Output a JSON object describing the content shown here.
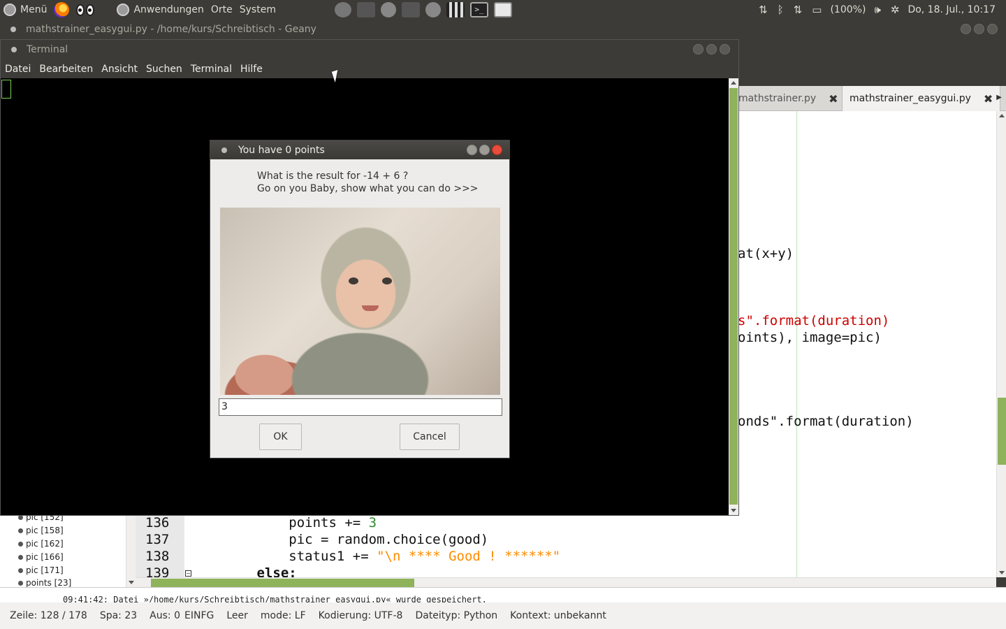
{
  "top_panel": {
    "menu_label": "Menü",
    "applications": "Anwendungen",
    "places": "Orte",
    "system": "System",
    "battery": "(100%)",
    "clock": "Do, 18. Jul., 10:17",
    "tray_icons": [
      "network-arrows-icon",
      "bluetooth-icon",
      "network-arrows-icon",
      "battery-icon",
      "volume-icon",
      "settings-icon"
    ]
  },
  "geany": {
    "window_title": "mathstrainer_easygui.py - /home/kurs/Schreibtisch - Geany",
    "tabs": [
      {
        "label": "mathstrainer.py"
      },
      {
        "label": "mathstrainer_easygui.py"
      }
    ],
    "code_visible_right": [
      "at(x+y)",
      "s\".format(duration)",
      "oints), image=pic)",
      "onds\".format(duration)"
    ],
    "code_lines": [
      {
        "num": "136",
        "indent": "            ",
        "parts": [
          "points += ",
          "3"
        ]
      },
      {
        "num": "137",
        "text": "            pic = random.choice(good)"
      },
      {
        "num": "138",
        "indent": "            ",
        "parts": [
          "status1 += ",
          "\"\\n **** Good ! ******\""
        ]
      },
      {
        "num": "139",
        "text": "        else:"
      }
    ],
    "symbols": [
      {
        "label": "pic [152]"
      },
      {
        "label": "pic [158]"
      },
      {
        "label": "pic [162]"
      },
      {
        "label": "pic [166]"
      },
      {
        "label": "pic [171]"
      },
      {
        "label": "points [23]"
      }
    ],
    "message": "09:41:42: Datei »/home/kurs/Schreibtisch/mathstrainer_easygui.py« wurde gespeichert.",
    "status": {
      "line": "Zeile: 128 / 178",
      "col": "Spa: 23",
      "sel": "Aus: 0",
      "mode": "EINFG",
      "indent": "Leer",
      "eol": "mode: LF",
      "encoding": "Kodierung: UTF-8",
      "filetype": "Dateityp: Python",
      "context": "Kontext: unbekannt"
    }
  },
  "terminal": {
    "title": "Terminal",
    "menu": [
      "Datei",
      "Bearbeiten",
      "Ansicht",
      "Suchen",
      "Terminal",
      "Hilfe"
    ]
  },
  "dialog": {
    "title": "You have 0 points",
    "message_line1": "What is the result for -14 + 6 ?",
    "message_line2": "Go on you Baby, show what you can do >>>",
    "input_value": "3",
    "ok_label": "OK",
    "cancel_label": "Cancel"
  }
}
